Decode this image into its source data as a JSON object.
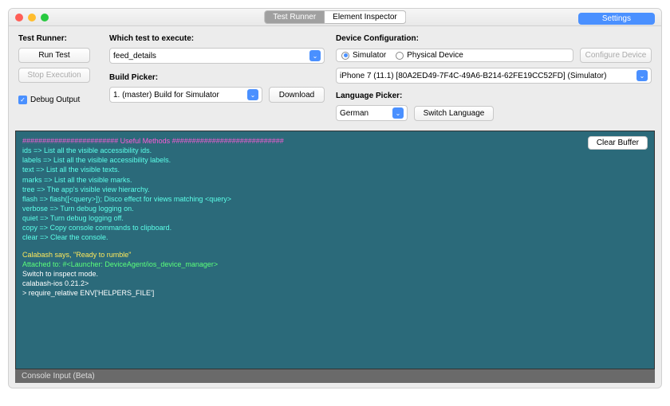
{
  "titlebar": {
    "tabs": {
      "runner": "Test Runner",
      "inspector": "Element Inspector"
    },
    "settings": "Settings"
  },
  "runner": {
    "header": "Test Runner:",
    "run": "Run Test",
    "stop": "Stop Execution",
    "debug_label": "Debug Output"
  },
  "test": {
    "which_label": "Which test to execute:",
    "which_value": "feed_details",
    "build_label": "Build Picker:",
    "build_value": "1. (master) Build for Simulator",
    "download": "Download"
  },
  "device": {
    "header": "Device Configuration:",
    "simulator": "Simulator",
    "physical": "Physical Device",
    "configure": "Configure Device",
    "selected": "iPhone 7 (11.1) [80A2ED49-7F4C-49A6-B214-62FE19CC52FD] (Simulator)",
    "lang_label": "Language Picker:",
    "lang_value": "German",
    "switch_lang": "Switch Language"
  },
  "console": {
    "clear": "Clear Buffer",
    "input_label": "Console Input (Beta)",
    "lines": {
      "hdr": "########################  Useful Methods  ############################",
      "l1": "    ids => List all the visible accessibility ids.",
      "l2": "    labels => List all the visible accessibility labels.",
      "l3": "    text => List all the visible texts.",
      "l4": "    marks => List all the visible marks.",
      "l5": "    tree => The app's visible view hierarchy.",
      "l6": "    flash => flash([<query>]); Disco effect for views matching <query>",
      "l7": "  verbose => Turn debug logging on.",
      "l8": "    quiet => Turn debug logging off.",
      "l9": "    copy => Copy console commands to clipboard.",
      "l10": "    clear => Clear the console.",
      "ready": "Calabash says, \"Ready to rumble\"",
      "attached": "Attached to: #<Launcher: DeviceAgent/ios_device_manager>",
      "switch": "Switch to inspect mode.",
      "prompt": "calabash-ios 0.21.2>",
      "cmd": ">               require_relative ENV['HELPERS_FILE']"
    }
  }
}
